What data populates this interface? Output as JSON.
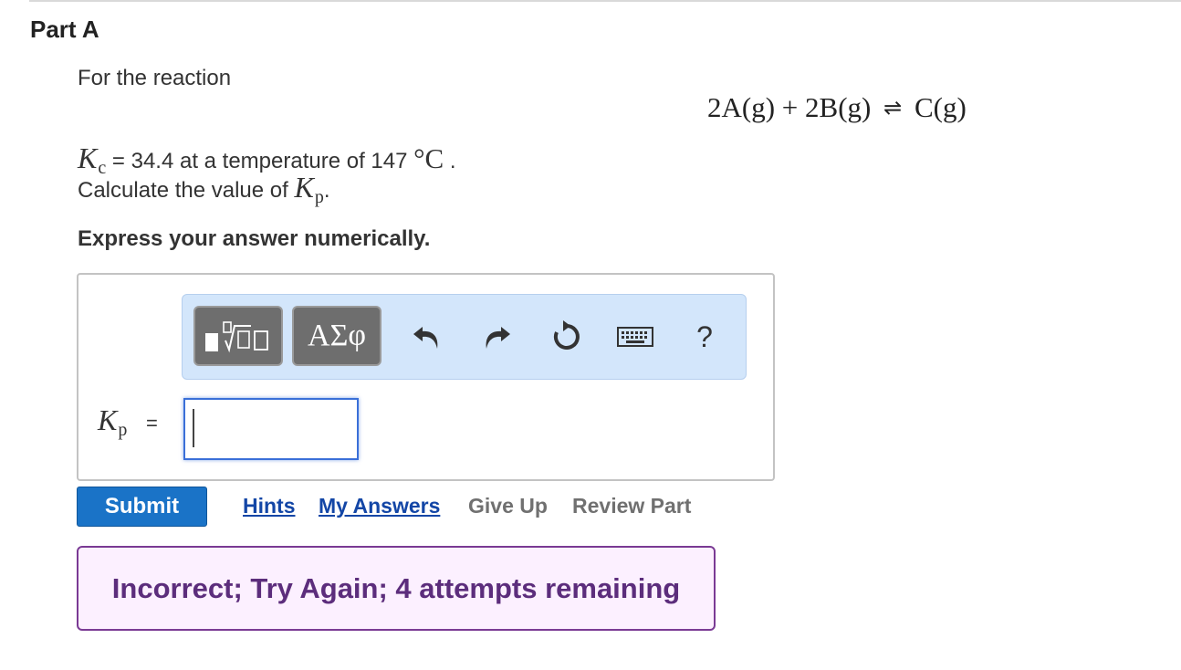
{
  "part": {
    "title": "Part A"
  },
  "question": {
    "intro": "For the reaction",
    "reaction": {
      "reactant1": "2A(g)",
      "plus": "+",
      "reactant2": "2B(g)",
      "arrow": "⇌",
      "product": "C(g)"
    },
    "kc_symbol": "K",
    "kc_subscript": "c",
    "kc_text": "= 34.4 at a temperature of 147",
    "temp_unit": "°C",
    "period": ".",
    "calc_text": "Calculate the value of",
    "kp_symbol": "K",
    "kp_subscript": "p",
    "express": "Express your answer numerically."
  },
  "toolbar": {
    "templates_icon": "templates-icon",
    "symbols_label": "ΑΣφ",
    "undo_icon": "undo-icon",
    "redo_icon": "redo-icon",
    "reset_icon": "reset-icon",
    "keyboard_icon": "keyboard-icon",
    "help_label": "?"
  },
  "answer": {
    "label_symbol": "K",
    "label_subscript": "p",
    "equals": "=",
    "value": ""
  },
  "actions": {
    "submit": "Submit",
    "hints": "Hints",
    "my_answers": "My Answers",
    "give_up": "Give Up",
    "review_part": "Review Part"
  },
  "feedback": {
    "message": "Incorrect; Try Again; 4 attempts remaining"
  },
  "colors": {
    "submit_bg": "#1a73c7",
    "link_active": "#1346a6",
    "link_muted": "#707070",
    "toolbar_bg": "#d3e6fb",
    "feedback_bg": "#fcf0ff",
    "feedback_border": "#7a3a94",
    "feedback_text": "#5c2d7c"
  }
}
